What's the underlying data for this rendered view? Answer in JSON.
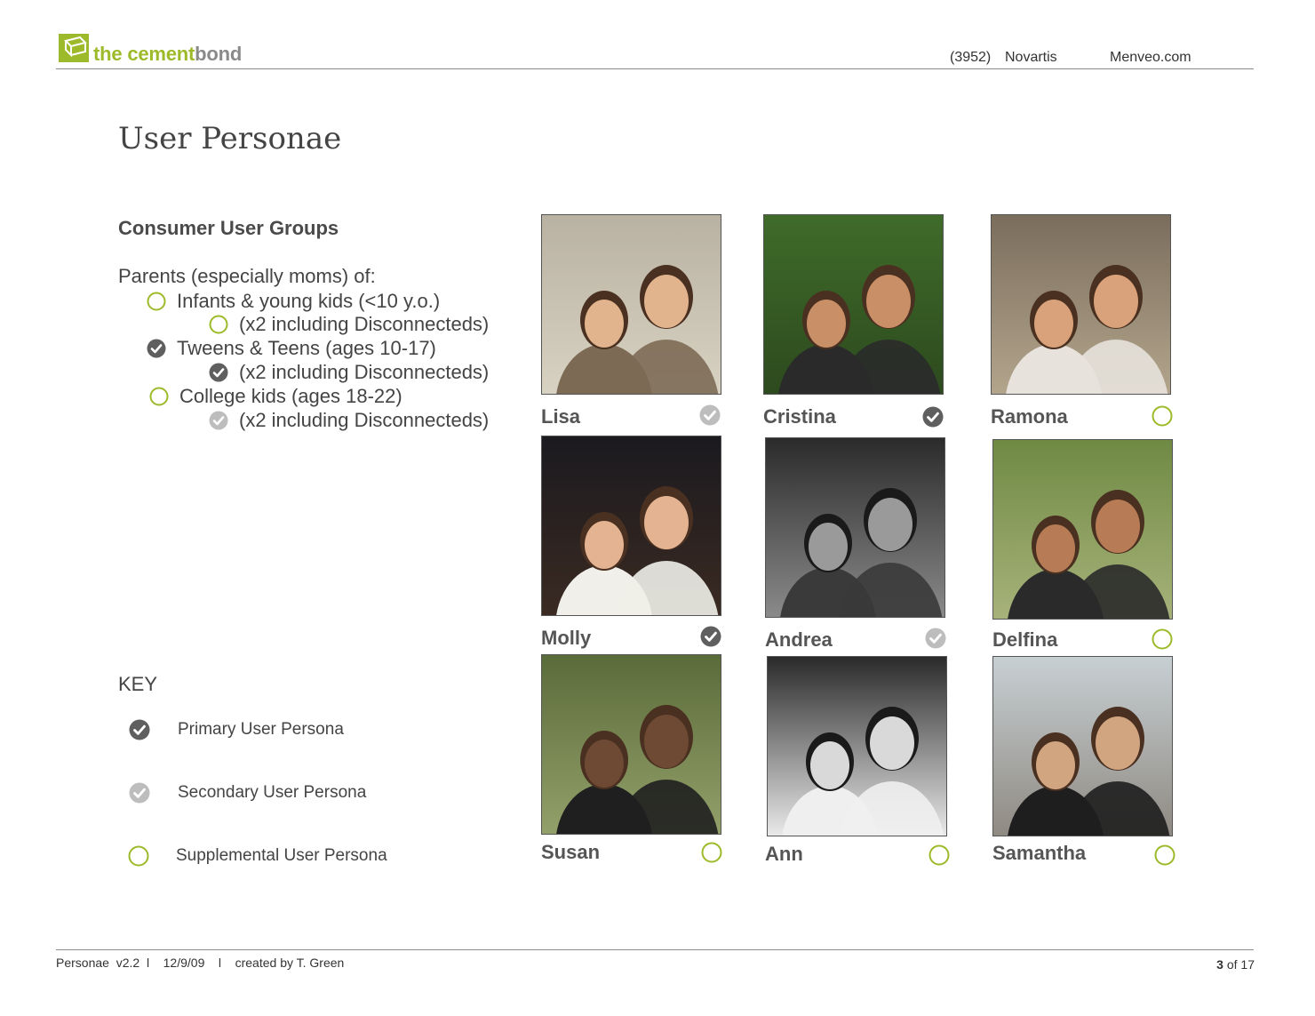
{
  "header": {
    "brand_the": "the ",
    "brand_cement": "cement",
    "brand_bond": "bond",
    "project_code": "(3952)",
    "client": "Novartis",
    "site": "Menveo.com"
  },
  "page_title": "User Personae",
  "groups": {
    "heading": "Consumer User Groups",
    "intro": "Parents (especially moms) of:",
    "items": [
      {
        "label": "Infants & young kids (<10 y.o.)",
        "status": "supplemental"
      },
      {
        "label": "(x2 including Disconnecteds)",
        "status": "supplemental"
      },
      {
        "label": "Tweens & Teens (ages 10-17)",
        "status": "primary"
      },
      {
        "label": "(x2 including Disconnecteds)",
        "status": "primary"
      },
      {
        "label": "College kids (ages 18-22)",
        "status": "supplemental"
      },
      {
        "label": "(x2 including Disconnecteds)",
        "status": "secondary"
      }
    ]
  },
  "key": {
    "heading": "KEY",
    "items": [
      {
        "label": "Primary User Persona",
        "status": "primary"
      },
      {
        "label": "Secondary User Persona",
        "status": "secondary"
      },
      {
        "label": "Supplemental User Persona",
        "status": "supplemental"
      }
    ]
  },
  "personas": [
    {
      "name": "Lisa",
      "status": "secondary"
    },
    {
      "name": "Cristina",
      "status": "primary"
    },
    {
      "name": "Ramona",
      "status": "supplemental"
    },
    {
      "name": "Molly",
      "status": "primary"
    },
    {
      "name": "Andrea",
      "status": "secondary"
    },
    {
      "name": "Delfina",
      "status": "supplemental"
    },
    {
      "name": "Susan",
      "status": "supplemental"
    },
    {
      "name": "Ann",
      "status": "supplemental"
    },
    {
      "name": "Samantha",
      "status": "supplemental"
    }
  ],
  "colors": {
    "primary": "#5f5f5f",
    "secondary": "#bdbdbd",
    "supplemental": "#9dba2a",
    "brand_green": "#9dba2a"
  },
  "footer": {
    "doc": "Personae  v2.2",
    "sep1": "l",
    "date": "12/9/09",
    "sep2": "l",
    "author": "created by T. Green",
    "page_current": "3",
    "page_of": "of 17"
  }
}
